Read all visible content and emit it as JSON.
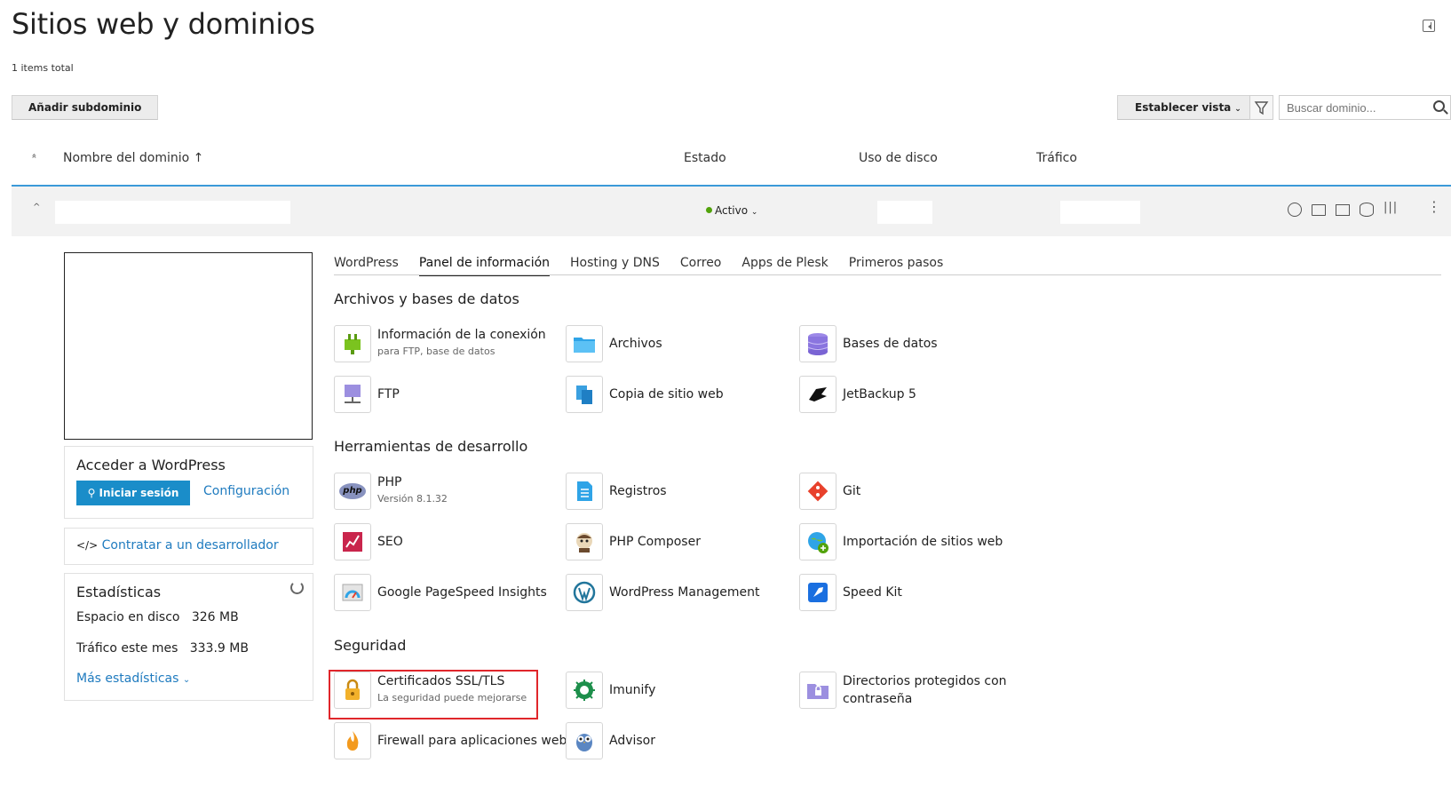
{
  "page": {
    "title": "Sitios web y dominios",
    "items_total": "1 items total"
  },
  "toolbar": {
    "add_subdomain": "Añadir subdominio",
    "set_view": "Establecer vista",
    "caret": "⌄",
    "search_placeholder": "Buscar dominio..."
  },
  "table": {
    "sort_icon": "«",
    "headers": {
      "domain": "Nombre del dominio ↑",
      "status": "Estado",
      "disk": "Uso de disco",
      "traffic": "Tráfico"
    }
  },
  "row": {
    "toggle": "^",
    "status": "Activo",
    "status_caret": "⌄",
    "status_color": "#52a30b",
    "kebab": "⋮",
    "icons": [
      "wordpress-icon",
      "folder-icon",
      "mail-icon",
      "database-icon",
      "settings-sliders-icon"
    ]
  },
  "wp_card": {
    "title": "Acceder a WordPress",
    "login": "Iniciar sesión",
    "login_icon": "⚲",
    "config": "Configuración"
  },
  "dev_card": {
    "icon": "</>",
    "link": "Contratar a un desarrollador"
  },
  "stats_card": {
    "title": "Estadísticas",
    "disk_label": "Espacio en disco",
    "disk_value": "326 MB",
    "traffic_label": "Tráfico este mes",
    "traffic_value": "333.9 MB",
    "more": "Más estadísticas",
    "more_caret": "⌄"
  },
  "tabs": [
    "WordPress",
    "Panel de información",
    "Hosting y DNS",
    "Correo",
    "Apps de Plesk",
    "Primeros pasos"
  ],
  "sections": {
    "files": {
      "title": "Archivos y bases de datos",
      "tools": [
        {
          "label": "Información de la conexión",
          "sub": "para FTP, base de datos"
        },
        {
          "label": "Archivos"
        },
        {
          "label": "Bases de datos"
        },
        {
          "label": "FTP"
        },
        {
          "label": "Copia de sitio web"
        },
        {
          "label": "JetBackup 5"
        }
      ]
    },
    "dev": {
      "title": "Herramientas de desarrollo",
      "tools": [
        {
          "label": "PHP",
          "sub": "Versión 8.1.32",
          "icon_text": "php"
        },
        {
          "label": "Registros"
        },
        {
          "label": "Git"
        },
        {
          "label": "SEO"
        },
        {
          "label": "PHP Composer"
        },
        {
          "label": "Importación de sitios web"
        },
        {
          "label": "Google PageSpeed Insights"
        },
        {
          "label": "WordPress Management"
        },
        {
          "label": "Speed Kit"
        }
      ]
    },
    "security": {
      "title": "Seguridad",
      "tools": [
        {
          "label": "Certificados SSL/TLS",
          "sub": "La seguridad puede mejorarse"
        },
        {
          "label": "Imunify"
        },
        {
          "label": "Directorios protegidos con",
          "label2": "contraseña"
        },
        {
          "label": "Firewall para aplicaciones web"
        },
        {
          "label": "Advisor"
        }
      ]
    }
  },
  "colors": {
    "accent": "#1a8dc9",
    "header_line": "#3b9ad9",
    "highlight": "#e0262b"
  }
}
